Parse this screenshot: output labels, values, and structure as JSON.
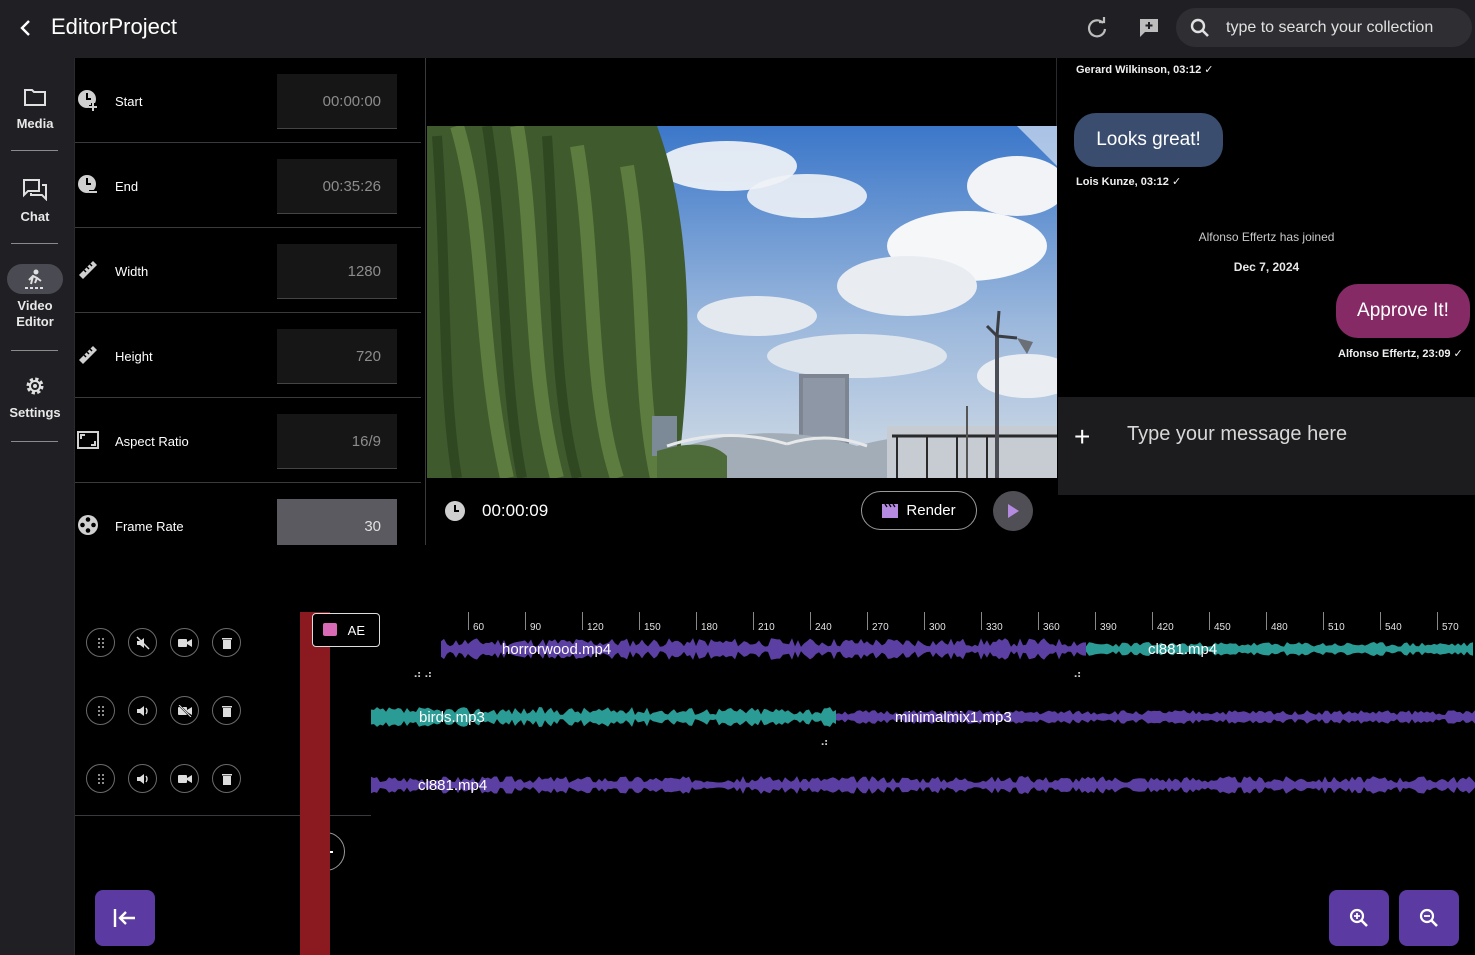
{
  "header": {
    "title": "EditorProject",
    "search_placeholder": "type to search your collection"
  },
  "sidebar": {
    "items": [
      {
        "label": "Media",
        "icon": "folder-icon"
      },
      {
        "label": "Chat",
        "icon": "chat-icon"
      },
      {
        "label": "Video Editor",
        "icon": "video-editor-icon",
        "active": true
      },
      {
        "label": "Settings",
        "icon": "gear-icon"
      }
    ]
  },
  "properties": {
    "rows": [
      {
        "label": "Start",
        "value": "00:00:00"
      },
      {
        "label": "End",
        "value": "00:35:26"
      },
      {
        "label": "Width",
        "value": "1280"
      },
      {
        "label": "Height",
        "value": "720"
      },
      {
        "label": "Aspect Ratio",
        "value": "16/9"
      },
      {
        "label": "Frame Rate",
        "value": "30"
      }
    ]
  },
  "player": {
    "time": "00:00:09",
    "render_label": "Render"
  },
  "chat": {
    "messages": [
      {
        "meta": "Gerard Wilkinson, 03:12"
      },
      {
        "text": "Looks great!",
        "meta": "Lois Kunze, 03:12"
      },
      {
        "system": "Alfonso Effertz has joined"
      },
      {
        "date": "Dec 7, 2024"
      },
      {
        "text": "Approve It!",
        "meta": "Alfonso Effertz, 23:09"
      }
    ],
    "composer_placeholder": "Type your message here"
  },
  "timeline": {
    "ruler": [
      "60",
      "90",
      "120",
      "150",
      "180",
      "210",
      "240",
      "270",
      "300",
      "330",
      "360",
      "390",
      "420",
      "450",
      "480",
      "510",
      "540",
      "570"
    ],
    "playhead_badge": "AE",
    "tracks": [
      {
        "clips": [
          "horrorwood.mp4",
          "cl881.mp4"
        ]
      },
      {
        "clips": [
          "birds.mp3",
          "minimalmix1.mp3"
        ]
      },
      {
        "clips": [
          "cl881.mp4"
        ]
      }
    ]
  },
  "colors": {
    "accent": "#5b3aa1",
    "clip_purple": "#5b3fa3",
    "clip_teal": "#2a9c95",
    "bubble_blue": "#3a4d6e",
    "bubble_magenta": "#862a66",
    "playhead": "#8b1a20"
  }
}
